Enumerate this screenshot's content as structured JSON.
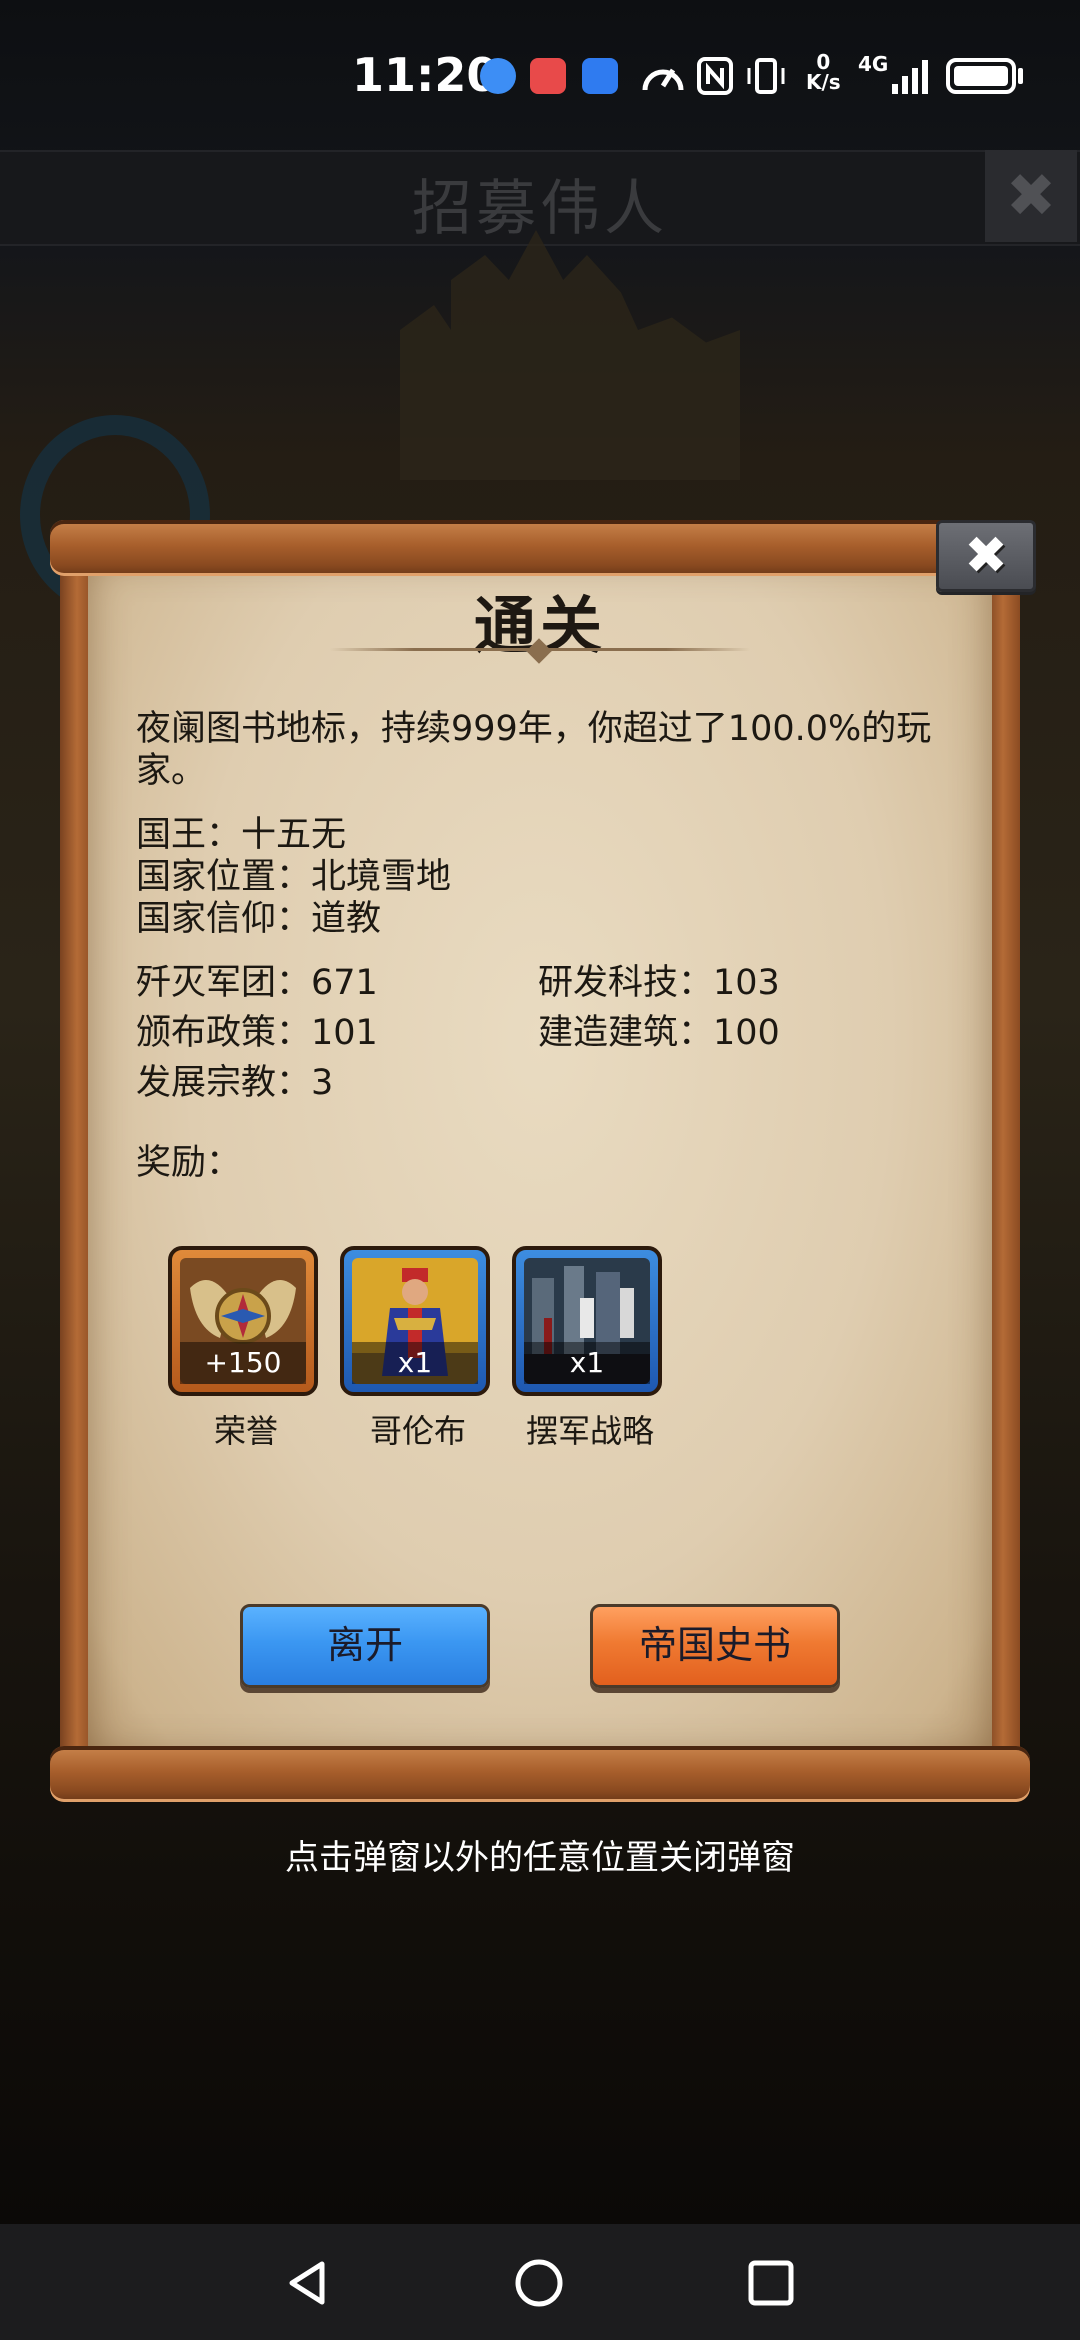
{
  "status_bar": {
    "time": "11:20",
    "net_speed_top": "0",
    "net_speed_bottom": "K/s",
    "network": "4G"
  },
  "background": {
    "title": "招募伟人",
    "close_label": "✖"
  },
  "dialog": {
    "close_label": "✖",
    "title": "通关",
    "summary": "夜阑图书地标，持续999年，你超过了100.0%的玩家。",
    "stats_left": [
      "国王：十五无",
      "国家位置：北境雪地",
      "国家信仰：道教"
    ],
    "stats_grid": [
      [
        "歼灭军团：671",
        "研发科技：103"
      ],
      [
        "颁布政策：101",
        "建造建筑：100"
      ],
      [
        "发展宗教：3",
        ""
      ]
    ],
    "reward_label": "奖励：",
    "rewards": [
      {
        "name": "荣誉",
        "qty": "+150",
        "frame": "orange"
      },
      {
        "name": "哥伦布",
        "qty": "x1",
        "frame": "blue"
      },
      {
        "name": "摆军战略",
        "qty": "x1",
        "frame": "blue"
      }
    ],
    "leave_button": "离开",
    "history_button": "帝国史书"
  },
  "hint": "点击弹窗以外的任意位置关闭弹窗",
  "colors": {
    "paper": "#e2d2b6",
    "wood": "#a85f2c",
    "blue_button": "#3b97f2",
    "orange_button": "#f07a32"
  }
}
